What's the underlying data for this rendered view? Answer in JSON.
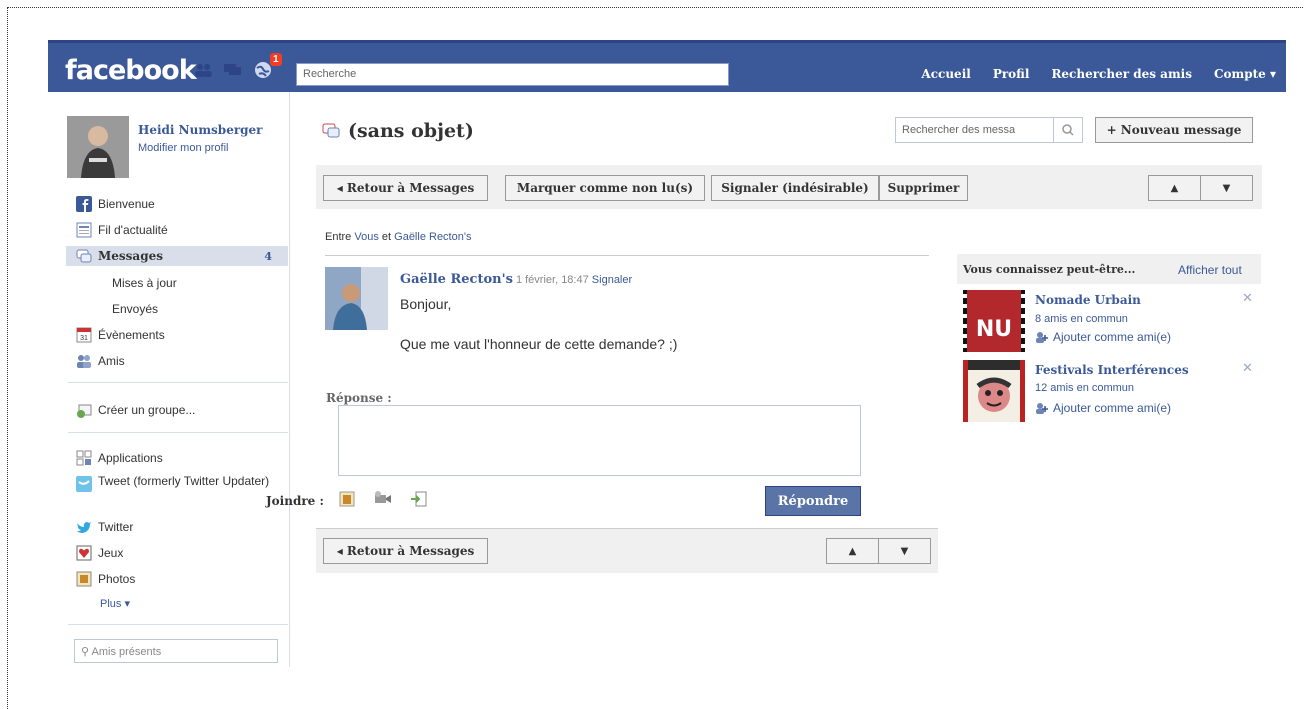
{
  "topbar": {
    "logo": "facebook",
    "notification_count": "1",
    "search_placeholder": "Recherche",
    "nav": [
      "Accueil",
      "Profil",
      "Rechercher des amis",
      "Compte ▾"
    ]
  },
  "profile": {
    "name": "Heidi Numsberger",
    "edit": "Modifier mon profil"
  },
  "sidebar": {
    "items": [
      {
        "label": "Bienvenue",
        "icon": "facebook-icon"
      },
      {
        "label": "Fil d'actualité",
        "icon": "news-feed-icon"
      },
      {
        "label": "Messages",
        "icon": "messages-icon",
        "count": "4"
      },
      {
        "label": "Mises à jour"
      },
      {
        "label": "Envoyés"
      },
      {
        "label": "Évènements",
        "icon": "calendar-icon"
      },
      {
        "label": "Amis",
        "icon": "friends-icon"
      },
      {
        "label": "Créer un groupe...",
        "icon": "group-icon"
      },
      {
        "label": "Applications",
        "icon": "apps-icon"
      },
      {
        "label": "Tweet (formerly Twitter Updater)",
        "icon": "tweet-icon"
      },
      {
        "label": "Twitter",
        "icon": "twitter-bird-icon"
      },
      {
        "label": "Jeux",
        "icon": "games-icon"
      },
      {
        "label": "Photos",
        "icon": "photos-icon"
      },
      {
        "label": "Plus ▾"
      }
    ],
    "amis_search": "Amis présents"
  },
  "main": {
    "title": "(sans objet)",
    "search_placeholder": "Rechercher des messa",
    "new_message": "+ Nouveau message",
    "back": "◂ Retour à Messages",
    "mark_unread": "Marquer comme non lu(s)",
    "report_spam": "Signaler (indésirable)",
    "delete": "Supprimer",
    "up": "▲",
    "down": "▼",
    "between_prefix": "Entre",
    "between_you": "Vous",
    "between_and": "et",
    "between_other": "Gaëlle Recton's",
    "sender": "Gaëlle Recton's",
    "date": "1 février, 18:47",
    "report": "Signaler",
    "line1": "Bonjour,",
    "line2": "Que me vaut l'honneur de cette demande? ;)",
    "reply_label": "Réponse :",
    "attach_label": "Joindre :",
    "reply_button": "Répondre"
  },
  "pymk": {
    "title": "Vous connaissez peut-être...",
    "see_all": "Afficher tout",
    "suggestions": [
      {
        "name": "Nomade Urbain",
        "mutual": "8 amis en commun",
        "add": "Ajouter comme ami(e)",
        "img_text": "NU"
      },
      {
        "name": "Festivals Interférences",
        "mutual": "12 amis en commun",
        "add": "Ajouter comme ami(e)"
      }
    ]
  },
  "colors": {
    "brand": "#3b5998",
    "topbar_border": "#2d4486",
    "selected_bg": "#d8dfea",
    "button_blue": "#5b74a8",
    "badge": "#f03d25"
  }
}
